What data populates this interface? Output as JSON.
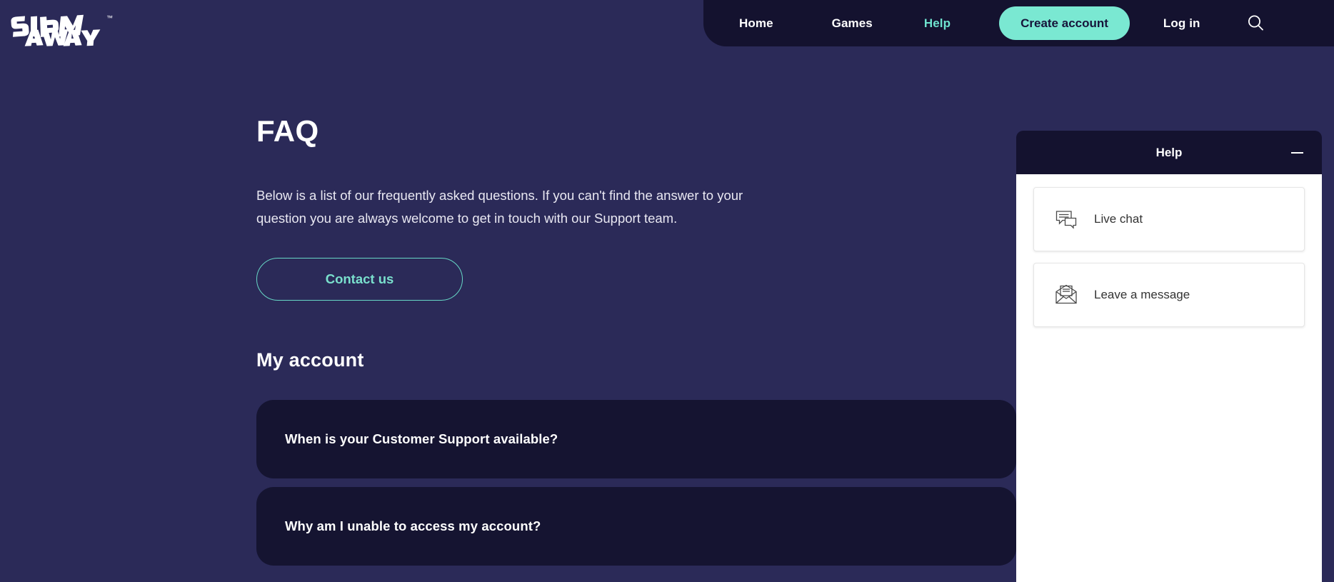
{
  "brand": {
    "name": "SPIN AWAY",
    "line1": "SPIN",
    "line2": "AWAY",
    "trademark": "™"
  },
  "header": {
    "nav_items": [
      {
        "label": "Home",
        "active": false
      },
      {
        "label": "Games",
        "active": false
      },
      {
        "label": "Help",
        "active": true
      }
    ],
    "create_account_label": "Create account",
    "login_label": "Log in",
    "search_icon": "search-icon"
  },
  "main": {
    "title": "FAQ",
    "intro": "Below is a list of our frequently asked questions. If you can't find the answer to your question you are always welcome to get in touch with our Support team.",
    "contact_label": "Contact us",
    "section_title": "My account",
    "faqs": [
      {
        "question": "When is your Customer Support available?"
      },
      {
        "question": "Why am I unable to access my account?"
      }
    ]
  },
  "help_widget": {
    "title": "Help",
    "minimize_icon": "minimize-icon",
    "options": [
      {
        "label": "Live chat",
        "icon": "chat-bubbles-icon"
      },
      {
        "label": "Leave a message",
        "icon": "envelope-icon"
      }
    ]
  },
  "colors": {
    "background": "#2b2a58",
    "panel_dark": "#14122f",
    "card_dark": "#151431",
    "accent_teal": "#7ae8d2",
    "accent_teal_text": "#6fe3cf",
    "white": "#ffffff"
  }
}
